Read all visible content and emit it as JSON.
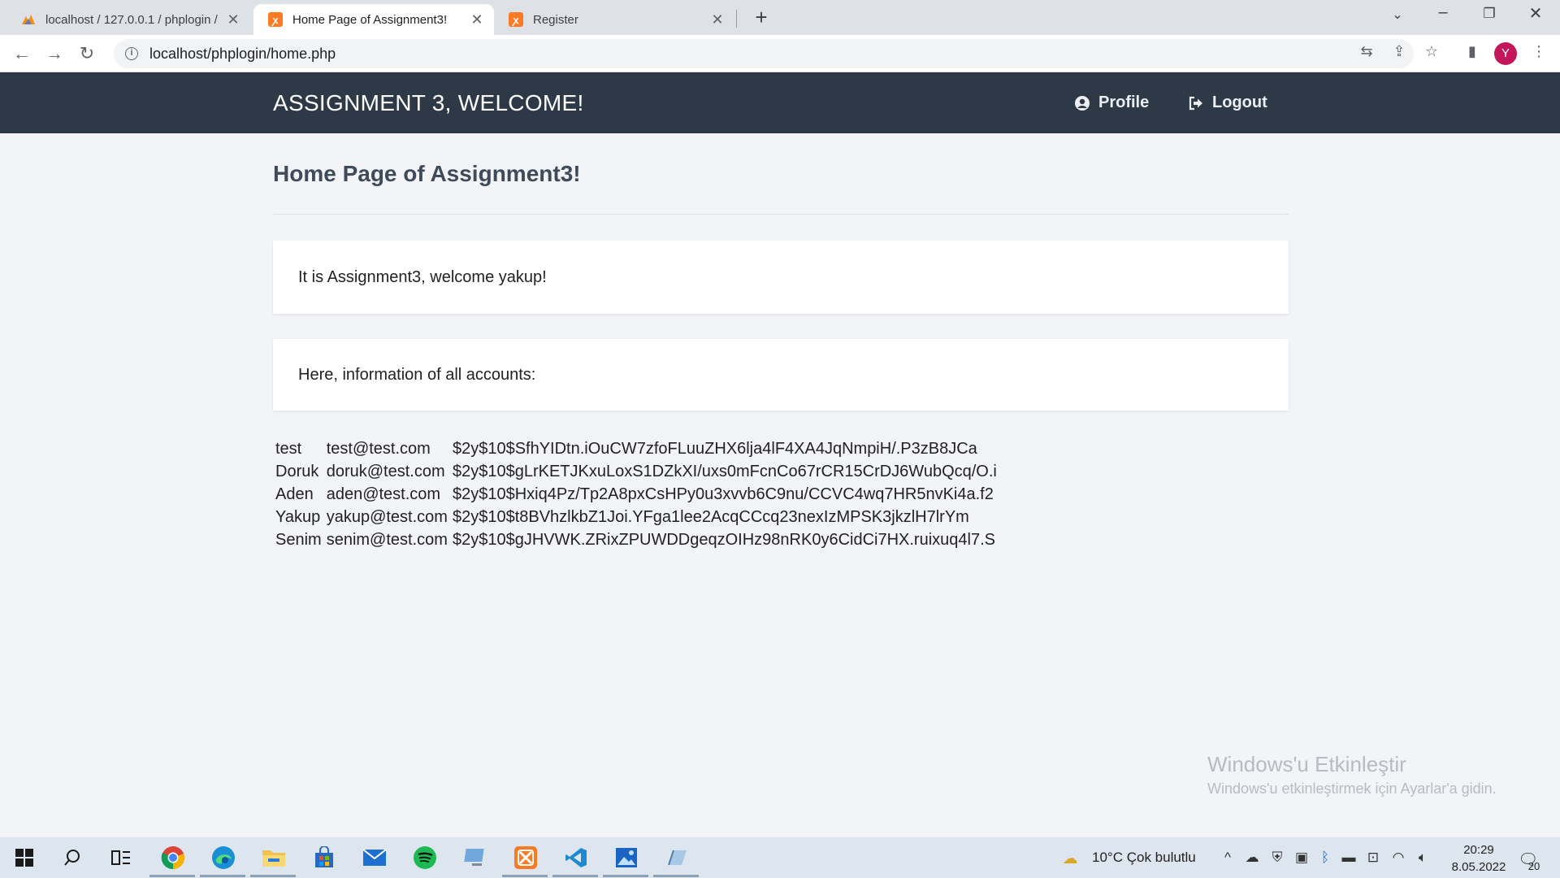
{
  "browser": {
    "tabs": [
      {
        "title": "localhost / 127.0.0.1 / phplogin /",
        "active": false
      },
      {
        "title": "Home Page of Assignment3!",
        "active": true
      },
      {
        "title": "Register",
        "active": false
      }
    ],
    "url": "localhost/phplogin/home.php",
    "profile_initial": "Y"
  },
  "navbar": {
    "brand": "ASSIGNMENT 3, WELCOME!",
    "profile_label": "Profile",
    "logout_label": "Logout"
  },
  "page": {
    "title": "Home Page of Assignment3!",
    "welcome_text": "It is Assignment3, welcome yakup!",
    "accounts_intro": "Here, information of all accounts:"
  },
  "accounts": [
    {
      "username": "test",
      "email": "test@test.com",
      "hash": "$2y$10$SfhYIDtn.iOuCW7zfoFLuuZHX6lja4lF4XA4JqNmpiH/.P3zB8JCa"
    },
    {
      "username": "Doruk",
      "email": "doruk@test.com",
      "hash": "$2y$10$gLrKETJKxuLoxS1DZkXI/uxs0mFcnCo67rCR15CrDJ6WubQcq/O.i"
    },
    {
      "username": "Aden",
      "email": "aden@test.com",
      "hash": "$2y$10$Hxiq4Pz/Tp2A8pxCsHPy0u3xvvb6C9nu/CCVC4wq7HR5nvKi4a.f2"
    },
    {
      "username": "Yakup",
      "email": "yakup@test.com",
      "hash": "$2y$10$t8BVhzlkbZ1Joi.YFga1lee2AcqCCcq23nexIzMPSK3jkzlH7lrYm"
    },
    {
      "username": "Senim",
      "email": "senim@test.com",
      "hash": "$2y$10$gJHVWK.ZRixZPUWDDgeqzOIHz98nRK0y6CidCi7HX.ruixuq4l7.S"
    }
  ],
  "watermark": {
    "title": "Windows'u Etkinleştir",
    "subtitle": "Windows'u etkinleştirmek için Ayarlar'a gidin."
  },
  "taskbar": {
    "weather": "10°C  Çok bulutlu",
    "time": "20:29",
    "date": "8.05.2022",
    "notifications": "20"
  }
}
